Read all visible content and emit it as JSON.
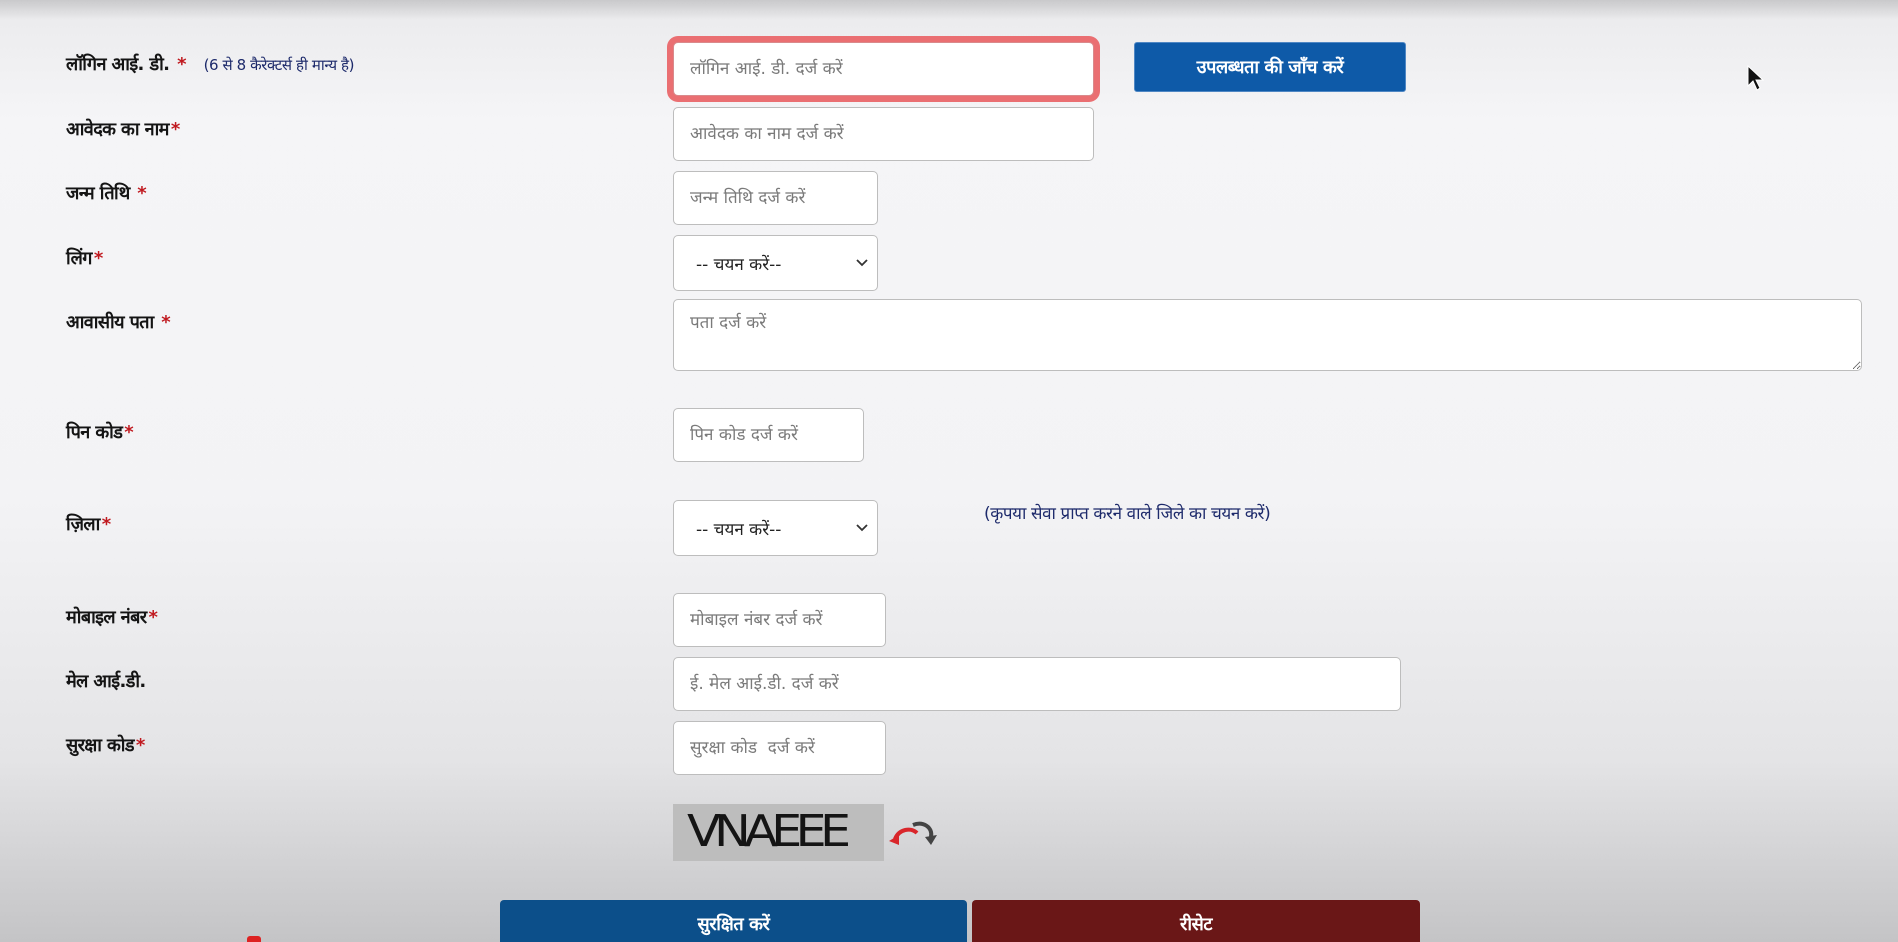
{
  "login": {
    "label": "लॉगिन आई. डी.",
    "required_mark": "*",
    "hint": "(6 से 8 कैरेक्टर्स ही मान्य है)",
    "placeholder": "लॉगिन आई. डी. दर्ज करें",
    "check_button": "उपलब्धता की जाँच करें"
  },
  "applicant_name": {
    "label": "आवेदक का नाम",
    "required_mark": "*",
    "placeholder": "आवेदक का नाम दर्ज करें"
  },
  "dob": {
    "label": "जन्म तिथि",
    "required_mark": "*",
    "placeholder": "जन्म तिथि दर्ज करें"
  },
  "gender": {
    "label": "लिंग",
    "required_mark": "*",
    "selected": "-- चयन करें--"
  },
  "address": {
    "label": "आवासीय पता",
    "required_mark": "*",
    "placeholder": "पता दर्ज करें"
  },
  "pincode": {
    "label": "पिन कोड",
    "required_mark": "*",
    "placeholder": "पिन कोड दर्ज करें"
  },
  "district": {
    "label": "ज़िला",
    "required_mark": "*",
    "selected": "-- चयन करें--",
    "note": "(कृपया सेवा प्राप्त करने वाले जिले का चयन करें)"
  },
  "mobile": {
    "label": "मोबाइल नंबर",
    "required_mark": "*",
    "placeholder": "मोबाइल नंबर दर्ज करें"
  },
  "email": {
    "label": "मेल आई.डी.",
    "placeholder": "ई. मेल आई.डी. दर्ज करें"
  },
  "security_code": {
    "label": "सुरक्षा कोड",
    "required_mark": "*",
    "placeholder": "सुरक्षा कोड  दर्ज करें",
    "captcha_text": "VNAEEE"
  },
  "actions": {
    "save": "सुरक्षित करें",
    "reset": "रीसेट"
  },
  "colors": {
    "primary_button": "#0e5aa8",
    "save_button": "#0c4f8a",
    "reset_button": "#6a1717",
    "focus_ring": "#ea6f72",
    "required": "#c0191f"
  }
}
